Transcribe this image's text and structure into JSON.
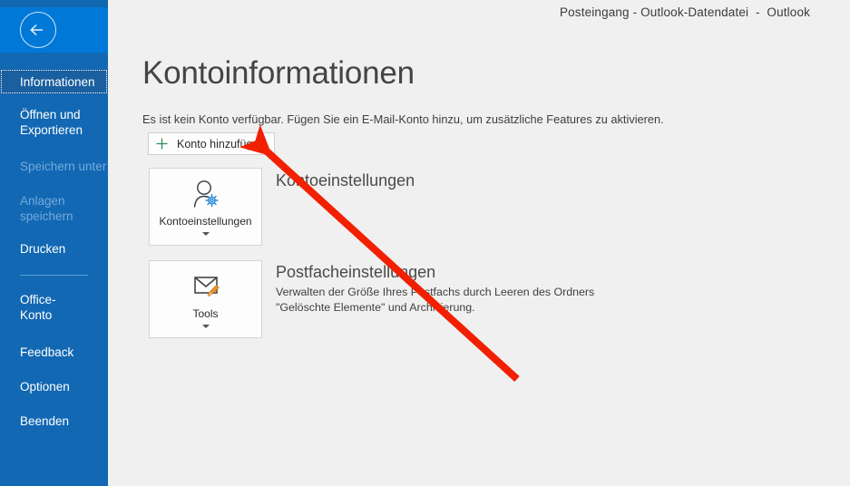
{
  "window": {
    "title": "Posteingang - Outlook-Datendatei  -  Outlook"
  },
  "sidebar": {
    "back_label": "back-arrow",
    "items": [
      {
        "label": "Informationen",
        "state": "selected"
      },
      {
        "label": "Öffnen und Exportieren",
        "state": "enabled"
      },
      {
        "label": "Speichern unter",
        "state": "disabled"
      },
      {
        "label": "Anlagen speichern",
        "state": "disabled"
      },
      {
        "label": "Drucken",
        "state": "enabled"
      },
      {
        "label": "Office-Konto",
        "state": "enabled"
      },
      {
        "label": "Feedback",
        "state": "enabled"
      },
      {
        "label": "Optionen",
        "state": "enabled"
      },
      {
        "label": "Beenden",
        "state": "enabled"
      }
    ]
  },
  "main": {
    "page_title": "Kontoinformationen",
    "account_description": "Es ist kein Konto verfügbar. Fügen Sie ein E-Mail-Konto hinzu, um zusätzliche Features zu aktivieren.",
    "add_account_button": "Konto hinzufügen",
    "sections": [
      {
        "tile_label": "Kontoeinstellungen",
        "tile_icon": "person-gear-icon",
        "title": "Kontoeinstellungen",
        "description": ""
      },
      {
        "tile_label": "Tools",
        "tile_icon": "envelope-broom-icon",
        "title": "Postfacheinstellungen",
        "description": "Verwalten der Größe Ihres Postfachs durch Leeren des Ordners \"Gelöschte Elemente\" und Archivierung."
      }
    ]
  },
  "colors": {
    "sidebar_blue": "#1268b3",
    "sidebar_header_blue": "#0078d7",
    "sidebar_selected": "#1a5fa0",
    "content_bg": "#f0f0f0",
    "annotation_red": "#f22000",
    "plus_green": "#2e8b57",
    "gear_blue": "#2b8ad4",
    "broom_orange": "#e8922a"
  }
}
